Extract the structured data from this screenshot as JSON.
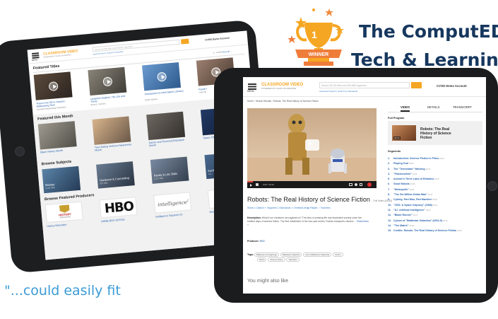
{
  "headline": {
    "line1": "The ComputED",
    "line2": "Tech & Learning"
  },
  "award": {
    "label": "WINNER",
    "number": "1"
  },
  "quote": "\"...could easily fit",
  "app": {
    "menu_label": "MENU",
    "logo": "CLASSROOM VIDEO",
    "logo_sub": "POWERED BY FILMS ON DEMAND",
    "search_placeholder_small": "Search 52,000 titles and 349,587 segments",
    "search_placeholder_large": "Search 45,130 titles and 205,685 segments",
    "advanced_search": "Advanced Search | Search by Standards",
    "account": "CVOD Demo Account"
  },
  "back_screen": {
    "featured_titles": {
      "heading": "Featured Titles",
      "pager": "1 - 4 of 8",
      "view_all": "View all →",
      "items": [
        {
          "title": "There's No 3G in Heaven: Addressing Teen",
          "producer": "Australian Broadcasting Corporation"
        },
        {
          "title": "Langston Hughes: His Life and Times",
          "producer": "Bruce E. Schwartz"
        },
        {
          "title": "Introduction to Information Literacy",
          "producer": "Motion Masters"
        },
        {
          "title": "Facial I",
          "producer": "Cold Offi"
        }
      ]
    },
    "featured_month": {
      "heading": "Featured this Month",
      "items": [
        "Black History Month",
        "Teen Dating Violence Awareness Month",
        "Career and Technical Education Month",
        "Space 2003"
      ]
    },
    "browse_subjects": {
      "heading": "Browse Subjects",
      "items": [
        {
          "name": "Biology",
          "count": "3,706 Titles"
        },
        {
          "name": "Guidance & Counseling",
          "count": "903 Titles"
        },
        {
          "name": "Family & Life Skills",
          "count": "1,227 Titles"
        },
        {
          "name": "Earth",
          "count": "1,8..."
        }
      ]
    },
    "browse_producers": {
      "heading": "Browse Featured Producers",
      "items": [
        {
          "name": "History Education",
          "logo_text": "HISTORY",
          "logo_sub": "EDUCATION"
        },
        {
          "name": "HOME BOX OFFICE",
          "logo_text": "HBO"
        },
        {
          "name": "Intelligence Squared US",
          "logo_text": "intelligence",
          "logo_sup": "2"
        },
        {
          "name": "Moder"
        }
      ]
    }
  },
  "front_screen": {
    "breadcrumb": "Home › Search Results › Robots: The Real History of Science Fiction",
    "video_time": "0:00 / 43:42",
    "title": "Robots: The Real History of Science Fiction",
    "title_suffix": "- Full Video (43:42)",
    "actions": "Share  ≤ Citation  ✂ Segment  ☑ Standards  <> Embed/Link  ▶ Playlist  ☆ Favorites",
    "description_label": "Description:",
    "description": "What if our creations turn against us? The idea of creating life has fascinated society since the earliest days of science fiction. The first installment of the four-part series, Robots transports viewers ...",
    "read_more": "Read More >",
    "producer_label": "Producer:",
    "producer": "BBC",
    "tags_label": "Tags:",
    "tags": [
      "Battlestar (reimagining)",
      "Battlestar Galactica",
      "Cylon (Battlestar Galactica)",
      "Fiction",
      "Robot",
      "Science fiction",
      "Television"
    ],
    "you_might": "You might also like",
    "tabs": [
      "VIDEO",
      "DETAILS",
      "TRANSCRIPT"
    ],
    "full_program_label": "Full Program",
    "full_program_title": "Robots: The Real History of Science Fiction",
    "full_program_time": "43:43",
    "segments_label": "Segments",
    "segments": [
      {
        "n": "1.",
        "title": "Introduction: Science Fiction in Films",
        "time": "01:30"
      },
      {
        "n": "2.",
        "title": "Playing God",
        "time": "03:33"
      },
      {
        "n": "3.",
        "title": "The \"Terminator\" Warning",
        "time": "03:31"
      },
      {
        "n": "4.",
        "title": "\"Frankenstein\"",
        "time": "01:59"
      },
      {
        "n": "5.",
        "title": "Asimov's Three Laws of Robotics",
        "time": "02:27"
      },
      {
        "n": "6.",
        "title": "Good Robots",
        "time": "03:38"
      },
      {
        "n": "7.",
        "title": "\"Metropolis\"",
        "time": "02:39"
      },
      {
        "n": "8.",
        "title": "\"The Six Million Dollar Man\"",
        "time": "01:47"
      },
      {
        "n": "9.",
        "title": "Cyborg: Part Man, Part Machine",
        "time": "03:00"
      },
      {
        "n": "10.",
        "title": "\"2001: A Space Odyssey\" (1968)",
        "time": "03:11"
      },
      {
        "n": "11.",
        "title": "\"A.I. Artificial Intelligence\"",
        "time": "03:22"
      },
      {
        "n": "12.",
        "title": "\"Blade Runner\"",
        "time": "03:27"
      },
      {
        "n": "13.",
        "title": "Cylons of \"Battlestar Galactica\" (2004-9)",
        "time": "03:16"
      },
      {
        "n": "14.",
        "title": "\"The Matrix\"",
        "time": "04:38"
      },
      {
        "n": "15.",
        "title": "Credits: Robots: The Real History of Science Fiction",
        "time": "00:30"
      }
    ]
  },
  "colors": {
    "accent": "#f5a623",
    "title_navy": "#16375e",
    "quote_blue": "#3a9bd5",
    "link": "#2a64b0"
  }
}
